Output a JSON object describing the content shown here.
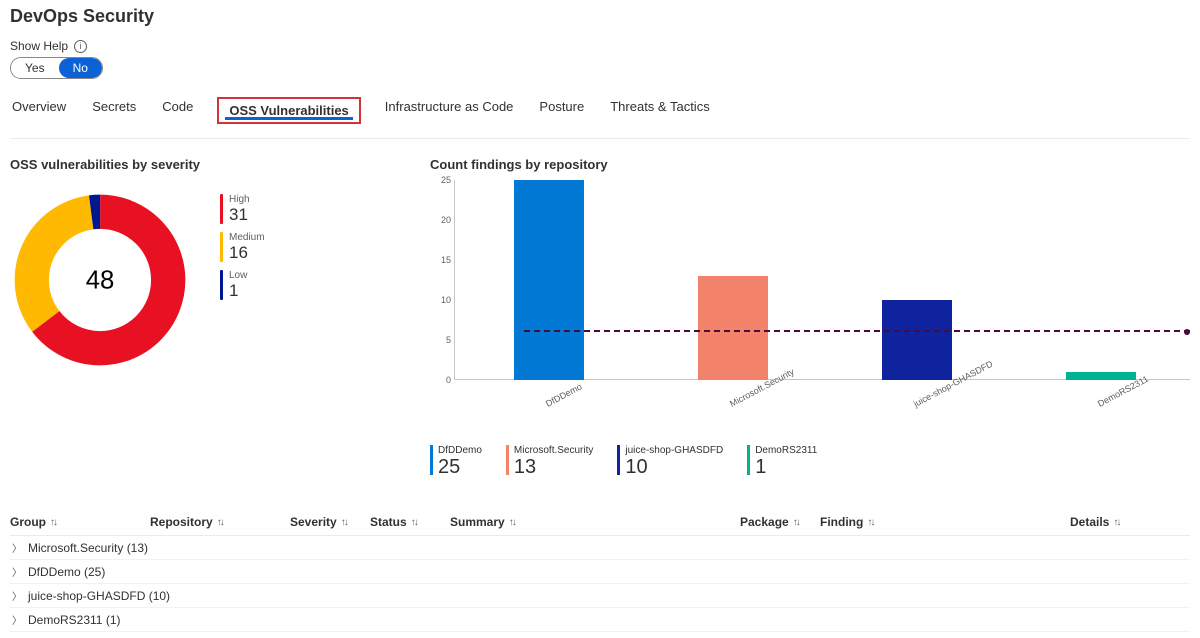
{
  "header": {
    "title": "DevOps Security"
  },
  "help": {
    "label": "Show Help",
    "yes": "Yes",
    "no": "No",
    "selected": "No"
  },
  "tabs": [
    {
      "id": "overview",
      "label": "Overview"
    },
    {
      "id": "secrets",
      "label": "Secrets"
    },
    {
      "id": "code",
      "label": "Code"
    },
    {
      "id": "oss",
      "label": "OSS Vulnerabilities",
      "selected": true,
      "highlighted": true
    },
    {
      "id": "iac",
      "label": "Infrastructure as Code"
    },
    {
      "id": "posture",
      "label": "Posture"
    },
    {
      "id": "threats",
      "label": "Threats & Tactics"
    }
  ],
  "severity_panel": {
    "title": "OSS vulnerabilities by severity",
    "total": 48,
    "items": [
      {
        "label": "High",
        "value": 31,
        "color": "#e81123"
      },
      {
        "label": "Medium",
        "value": 16,
        "color": "#ffb900"
      },
      {
        "label": "Low",
        "value": 1,
        "color": "#00188f"
      }
    ]
  },
  "repo_panel": {
    "title": "Count findings by repository",
    "legend": [
      {
        "label": "DfDDemo",
        "value": 25,
        "color": "#0078d4"
      },
      {
        "label": "Microsoft.Security",
        "value": 13,
        "color": "#f2826a"
      },
      {
        "label": "juice-shop-GHASDFD",
        "value": 10,
        "color": "#10239e"
      },
      {
        "label": "DemoRS2311",
        "value": 1,
        "color": "#00b294"
      }
    ]
  },
  "chart_data": {
    "type": "bar",
    "title": "Count findings by repository",
    "xlabel": "",
    "ylabel": "",
    "ylim": [
      0,
      25
    ],
    "yticks": [
      0,
      5,
      10,
      15,
      20,
      25
    ],
    "categories": [
      "DfDDemo",
      "Microsoft.Security",
      "juice-shop-GHASDFD",
      "DemoRS2311"
    ],
    "values": [
      25,
      13,
      10,
      1
    ],
    "colors": [
      "#0078d4",
      "#f2826a",
      "#10239e",
      "#00b294"
    ],
    "reference_line": 6
  },
  "table": {
    "columns": [
      "Group",
      "Repository",
      "Severity",
      "Status",
      "Summary",
      "Package",
      "Finding",
      "Details"
    ],
    "groups": [
      {
        "label": "Microsoft.Security (13)"
      },
      {
        "label": "DfDDemo (25)"
      },
      {
        "label": "juice-shop-GHASDFD (10)"
      },
      {
        "label": "DemoRS2311 (1)"
      }
    ]
  }
}
